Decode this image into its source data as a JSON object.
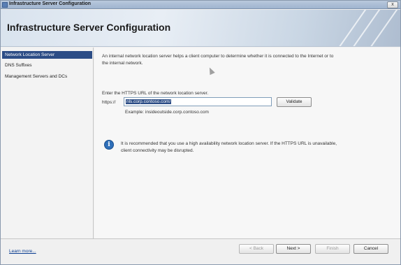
{
  "window": {
    "title": "Infrastructure Server Configuration",
    "close_label": "x"
  },
  "header": {
    "title": "Infrastructure Server Configuration"
  },
  "nav": {
    "items": [
      {
        "label": "Network Location Server",
        "active": true
      },
      {
        "label": "DNS Suffixes",
        "active": false
      },
      {
        "label": "Management Servers and DCs",
        "active": false
      }
    ]
  },
  "content": {
    "intro": "An internal network location server helps a client computer to determine whether it is connected to the Internet or to the internal network.",
    "url_label": "Enter the HTTPS URL of the network location server.",
    "url_prefix": "https://",
    "url_value": "nls.corp.contoso.com/",
    "validate_label": "Validate",
    "example": "Example: insideoutside.corp.contoso.com",
    "info_text": "It is recommended that you use a high availability network location server. If the HTTPS URL is unavailable, client connectivity may be disrupted.",
    "info_icon_glyph": "i"
  },
  "footer": {
    "learn_more": "Learn more...",
    "back_label": "< Back",
    "next_label": "Next >",
    "finish_label": "Finish",
    "cancel_label": "Cancel"
  },
  "colors": {
    "accent": "#2c4d86",
    "link": "#0a3d91",
    "info": "#2f6fb9"
  },
  "icons": {
    "title": "app-icon",
    "info": "info-icon",
    "cursor": "mouse-pointer-icon"
  }
}
